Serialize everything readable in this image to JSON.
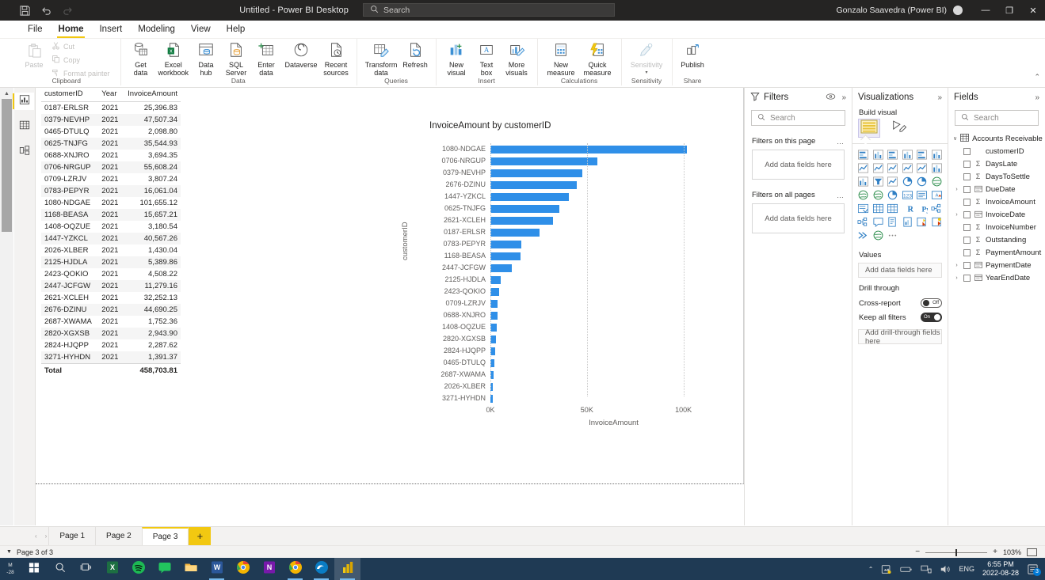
{
  "titlebar": {
    "title": "Untitled - Power BI Desktop",
    "save_icon": "save-icon",
    "undo_icon": "undo-icon",
    "redo_icon": "redo-icon",
    "search_placeholder": "Search",
    "user": "Gonzalo Saavedra (Power BI)",
    "minimize": "—",
    "maximize": "❐",
    "close": "✕"
  },
  "ribbon": {
    "tabs": [
      {
        "label": "File",
        "active": false
      },
      {
        "label": "Home",
        "active": true
      },
      {
        "label": "Insert",
        "active": false
      },
      {
        "label": "Modeling",
        "active": false
      },
      {
        "label": "View",
        "active": false
      },
      {
        "label": "Help",
        "active": false
      }
    ],
    "groups": [
      {
        "label": "Clipboard",
        "paste": "Paste",
        "items": [
          {
            "label": "Cut",
            "icon": "scissors-icon",
            "disabled": true
          },
          {
            "label": "Copy",
            "icon": "copy-icon",
            "disabled": true
          },
          {
            "label": "Format painter",
            "icon": "format-painter-icon",
            "disabled": true
          }
        ]
      },
      {
        "label": "Data",
        "items": [
          {
            "label": "Get\ndata",
            "icon": "get-data-icon",
            "caret": true
          },
          {
            "label": "Excel\nworkbook",
            "icon": "excel-icon",
            "caret": false
          },
          {
            "label": "Data\nhub",
            "icon": "data-hub-icon",
            "caret": true
          },
          {
            "label": "SQL\nServer",
            "icon": "sql-server-icon",
            "caret": false
          },
          {
            "label": "Enter\ndata",
            "icon": "enter-data-icon",
            "caret": false
          },
          {
            "label": "Dataverse",
            "icon": "dataverse-icon",
            "caret": false
          },
          {
            "label": "Recent\nsources",
            "icon": "recent-sources-icon",
            "caret": true
          }
        ]
      },
      {
        "label": "Queries",
        "items": [
          {
            "label": "Transform\ndata",
            "icon": "transform-data-icon",
            "caret": true
          },
          {
            "label": "Refresh",
            "icon": "refresh-icon",
            "caret": false
          }
        ]
      },
      {
        "label": "Insert",
        "items": [
          {
            "label": "New\nvisual",
            "icon": "new-visual-icon",
            "caret": false
          },
          {
            "label": "Text\nbox",
            "icon": "text-box-icon",
            "caret": false
          },
          {
            "label": "More\nvisuals",
            "icon": "more-visuals-icon",
            "caret": true
          }
        ]
      },
      {
        "label": "Calculations",
        "items": [
          {
            "label": "New\nmeasure",
            "icon": "new-measure-icon",
            "caret": false
          },
          {
            "label": "Quick\nmeasure",
            "icon": "quick-measure-icon",
            "caret": false
          }
        ]
      },
      {
        "label": "Sensitivity",
        "items": [
          {
            "label": "Sensitivity",
            "icon": "sensitivity-icon",
            "caret": true,
            "disabled": true
          }
        ]
      },
      {
        "label": "Share",
        "items": [
          {
            "label": "Publish",
            "icon": "publish-icon",
            "caret": false
          }
        ]
      }
    ]
  },
  "viewbar": {
    "items": [
      {
        "name": "report-view",
        "icon": "report-view-icon",
        "active": true
      },
      {
        "name": "data-view",
        "icon": "data-view-icon",
        "active": false
      },
      {
        "name": "model-view",
        "icon": "model-view-icon",
        "active": false
      }
    ]
  },
  "table_visual": {
    "columns": [
      "customerID",
      "Year",
      "InvoiceAmount"
    ],
    "rows": [
      [
        "0187-ERLSR",
        "2021",
        "25,396.83"
      ],
      [
        "0379-NEVHP",
        "2021",
        "47,507.34"
      ],
      [
        "0465-DTULQ",
        "2021",
        "2,098.80"
      ],
      [
        "0625-TNJFG",
        "2021",
        "35,544.93"
      ],
      [
        "0688-XNJRO",
        "2021",
        "3,694.35"
      ],
      [
        "0706-NRGUP",
        "2021",
        "55,608.24"
      ],
      [
        "0709-LZRJV",
        "2021",
        "3,807.24"
      ],
      [
        "0783-PEPYR",
        "2021",
        "16,061.04"
      ],
      [
        "1080-NDGAE",
        "2021",
        "101,655.12"
      ],
      [
        "1168-BEASA",
        "2021",
        "15,657.21"
      ],
      [
        "1408-OQZUE",
        "2021",
        "3,180.54"
      ],
      [
        "1447-YZKCL",
        "2021",
        "40,567.26"
      ],
      [
        "2026-XLBER",
        "2021",
        "1,430.04"
      ],
      [
        "2125-HJDLA",
        "2021",
        "5,389.86"
      ],
      [
        "2423-QOKIO",
        "2021",
        "4,508.22"
      ],
      [
        "2447-JCFGW",
        "2021",
        "11,279.16"
      ],
      [
        "2621-XCLEH",
        "2021",
        "32,252.13"
      ],
      [
        "2676-DZINU",
        "2021",
        "44,690.25"
      ],
      [
        "2687-XWAMA",
        "2021",
        "1,752.36"
      ],
      [
        "2820-XGXSB",
        "2021",
        "2,943.90"
      ],
      [
        "2824-HJQPP",
        "2021",
        "2,287.62"
      ],
      [
        "3271-HYHDN",
        "2021",
        "1,391.37"
      ]
    ],
    "total_label": "Total",
    "total_value": "458,703.81"
  },
  "chart_data": {
    "type": "bar",
    "orientation": "horizontal",
    "title": "InvoiceAmount by customerID",
    "xlabel": "InvoiceAmount",
    "ylabel": "customerID",
    "xlim": [
      0,
      110000
    ],
    "xticks": [
      0,
      50000,
      100000
    ],
    "xticklabels": [
      "0K",
      "50K",
      "100K"
    ],
    "grid": true,
    "bar_color": "#2f8fe8",
    "categories": [
      "1080-NDGAE",
      "0706-NRGUP",
      "0379-NEVHP",
      "2676-DZINU",
      "1447-YZKCL",
      "0625-TNJFG",
      "2621-XCLEH",
      "0187-ERLSR",
      "0783-PEPYR",
      "1168-BEASA",
      "2447-JCFGW",
      "2125-HJDLA",
      "2423-QOKIO",
      "0709-LZRJV",
      "0688-XNJRO",
      "1408-OQZUE",
      "2820-XGXSB",
      "2824-HJQPP",
      "0465-DTULQ",
      "2687-XWAMA",
      "2026-XLBER",
      "3271-HYHDN"
    ],
    "values": [
      101655.12,
      55608.24,
      47507.34,
      44690.25,
      40567.26,
      35544.93,
      32252.13,
      25396.83,
      16061.04,
      15657.21,
      11279.16,
      5389.86,
      4508.22,
      3807.24,
      3694.35,
      3180.54,
      2943.9,
      2287.62,
      2098.8,
      1752.36,
      1430.04,
      1391.37
    ]
  },
  "filters_pane": {
    "title": "Filters",
    "filter_icon": "filter-icon",
    "eye_icon": "eye-icon",
    "collapse_icon": "chevron-double-right-icon",
    "search_placeholder": "Search",
    "sections": [
      {
        "label": "Filters on this page",
        "dropzone": "Add data fields here",
        "more": "…"
      },
      {
        "label": "Filters on all pages",
        "dropzone": "Add data fields here",
        "more": "…"
      }
    ]
  },
  "visualizations_pane": {
    "title": "Visualizations",
    "collapse_icon": "chevron-double-right-icon",
    "build_label": "Build visual",
    "modes": [
      {
        "name": "build-visual-mode",
        "icon": "fields-grid-icon",
        "selected": true
      },
      {
        "name": "format-visual-mode",
        "icon": "format-paint-icon",
        "selected": false
      }
    ],
    "values_label": "Values",
    "values_placeholder": "Add data fields here",
    "drill_label": "Drill through",
    "cross_report_label": "Cross-report",
    "cross_report_state": "Off",
    "keep_filters_label": "Keep all filters",
    "keep_filters_state": "On",
    "drill_placeholder": "Add drill-through fields here",
    "viz_icons": [
      "stacked-bar-chart-icon",
      "stacked-column-chart-icon",
      "clustered-bar-chart-icon",
      "clustered-column-chart-icon",
      "100-stacked-bar-chart-icon",
      "100-stacked-column-chart-icon",
      "line-chart-icon",
      "area-chart-icon",
      "stacked-area-chart-icon",
      "line-stacked-column-icon",
      "line-clustered-column-icon",
      "ribbon-chart-icon",
      "waterfall-chart-icon",
      "funnel-chart-icon",
      "scatter-chart-icon",
      "pie-chart-icon",
      "donut-chart-icon",
      "treemap-icon",
      "map-icon",
      "filled-map-icon",
      "gauge-icon",
      "card-icon",
      "multirow-card-icon",
      "kpi-icon",
      "slicer-icon",
      "table-icon",
      "matrix-icon",
      "r-script-visual-icon",
      "python-visual-icon",
      "decomposition-tree-icon",
      "key-influencers-icon",
      "qna-icon",
      "smart-narrative-icon",
      "paginated-report-icon",
      "power-apps-icon",
      "power-automate-icon",
      "arrow-visual-icon",
      "azure-map-icon",
      "more-options-icon"
    ]
  },
  "fields_pane": {
    "title": "Fields",
    "collapse_icon": "chevron-double-right-icon",
    "search_placeholder": "Search",
    "table_name": "Accounts Receivable Log",
    "table_icon": "table-icon",
    "fields": [
      {
        "label": "customerID",
        "expandable": false,
        "sigma": false,
        "date": false
      },
      {
        "label": "DaysLate",
        "expandable": false,
        "sigma": true,
        "date": false
      },
      {
        "label": "DaysToSettle",
        "expandable": false,
        "sigma": true,
        "date": false
      },
      {
        "label": "DueDate",
        "expandable": true,
        "sigma": false,
        "date": true
      },
      {
        "label": "InvoiceAmount",
        "expandable": false,
        "sigma": true,
        "date": false
      },
      {
        "label": "InvoiceDate",
        "expandable": true,
        "sigma": false,
        "date": true
      },
      {
        "label": "InvoiceNumber",
        "expandable": false,
        "sigma": true,
        "date": false
      },
      {
        "label": "Outstanding",
        "expandable": false,
        "sigma": true,
        "date": false
      },
      {
        "label": "PaymentAmount",
        "expandable": false,
        "sigma": true,
        "date": false
      },
      {
        "label": "PaymentDate",
        "expandable": true,
        "sigma": false,
        "date": true
      },
      {
        "label": "YearEndDate",
        "expandable": true,
        "sigma": false,
        "date": true
      }
    ]
  },
  "page_tabs": {
    "prev": "‹",
    "next": "›",
    "tabs": [
      {
        "label": "Page 1",
        "active": false
      },
      {
        "label": "Page 2",
        "active": false
      },
      {
        "label": "Page 3",
        "active": true
      }
    ],
    "add_label": "+"
  },
  "statusbar": {
    "page_status": "Page 3 of 3",
    "zoom_out": "−",
    "zoom_in": "+",
    "zoom_level": "103%",
    "fit_icon": "fit-to-page-icon"
  },
  "taskbar": {
    "clock_left_time": "M",
    "clock_left_date": "-28",
    "start_icon": "windows-start-icon",
    "search_icon": "search-icon",
    "taskview_icon": "task-view-icon",
    "apps": [
      {
        "name": "excel",
        "icon": "excel-icon",
        "color": "#1d6f42",
        "glyph": "X",
        "running": false
      },
      {
        "name": "spotify",
        "icon": "spotify-icon",
        "color": "#1db954",
        "glyph": "",
        "running": false
      },
      {
        "name": "messaging",
        "icon": "messaging-icon",
        "color": "#22c55e",
        "glyph": "",
        "running": false
      },
      {
        "name": "file-explorer",
        "icon": "file-explorer-icon",
        "color": "#f2b33d",
        "glyph": "",
        "running": false
      },
      {
        "name": "word",
        "icon": "word-icon",
        "color": "#2b579a",
        "glyph": "W",
        "running": true
      },
      {
        "name": "chrome",
        "icon": "chrome-icon",
        "color": "#f4b400",
        "glyph": "",
        "running": false
      },
      {
        "name": "onenote",
        "icon": "onenote-icon",
        "color": "#7719aa",
        "glyph": "N",
        "running": false
      },
      {
        "name": "chrome-2",
        "icon": "chrome-icon",
        "color": "#f4b400",
        "glyph": "",
        "running": true
      },
      {
        "name": "edge",
        "icon": "edge-icon",
        "color": "#0a7cc4",
        "glyph": "",
        "running": true
      },
      {
        "name": "power-bi",
        "icon": "power-bi-icon",
        "color": "#f2c811",
        "glyph": "",
        "running": true,
        "active": true
      }
    ],
    "tray": {
      "chevron": "∧",
      "icons": [
        "onedrive-icon",
        "battery-icon",
        "network-icon",
        "volume-icon"
      ],
      "language": "ENG",
      "time": "6:55 PM",
      "date": "2022-08-28",
      "notification_icon": "notifications-icon",
      "notification_count": "3"
    }
  }
}
